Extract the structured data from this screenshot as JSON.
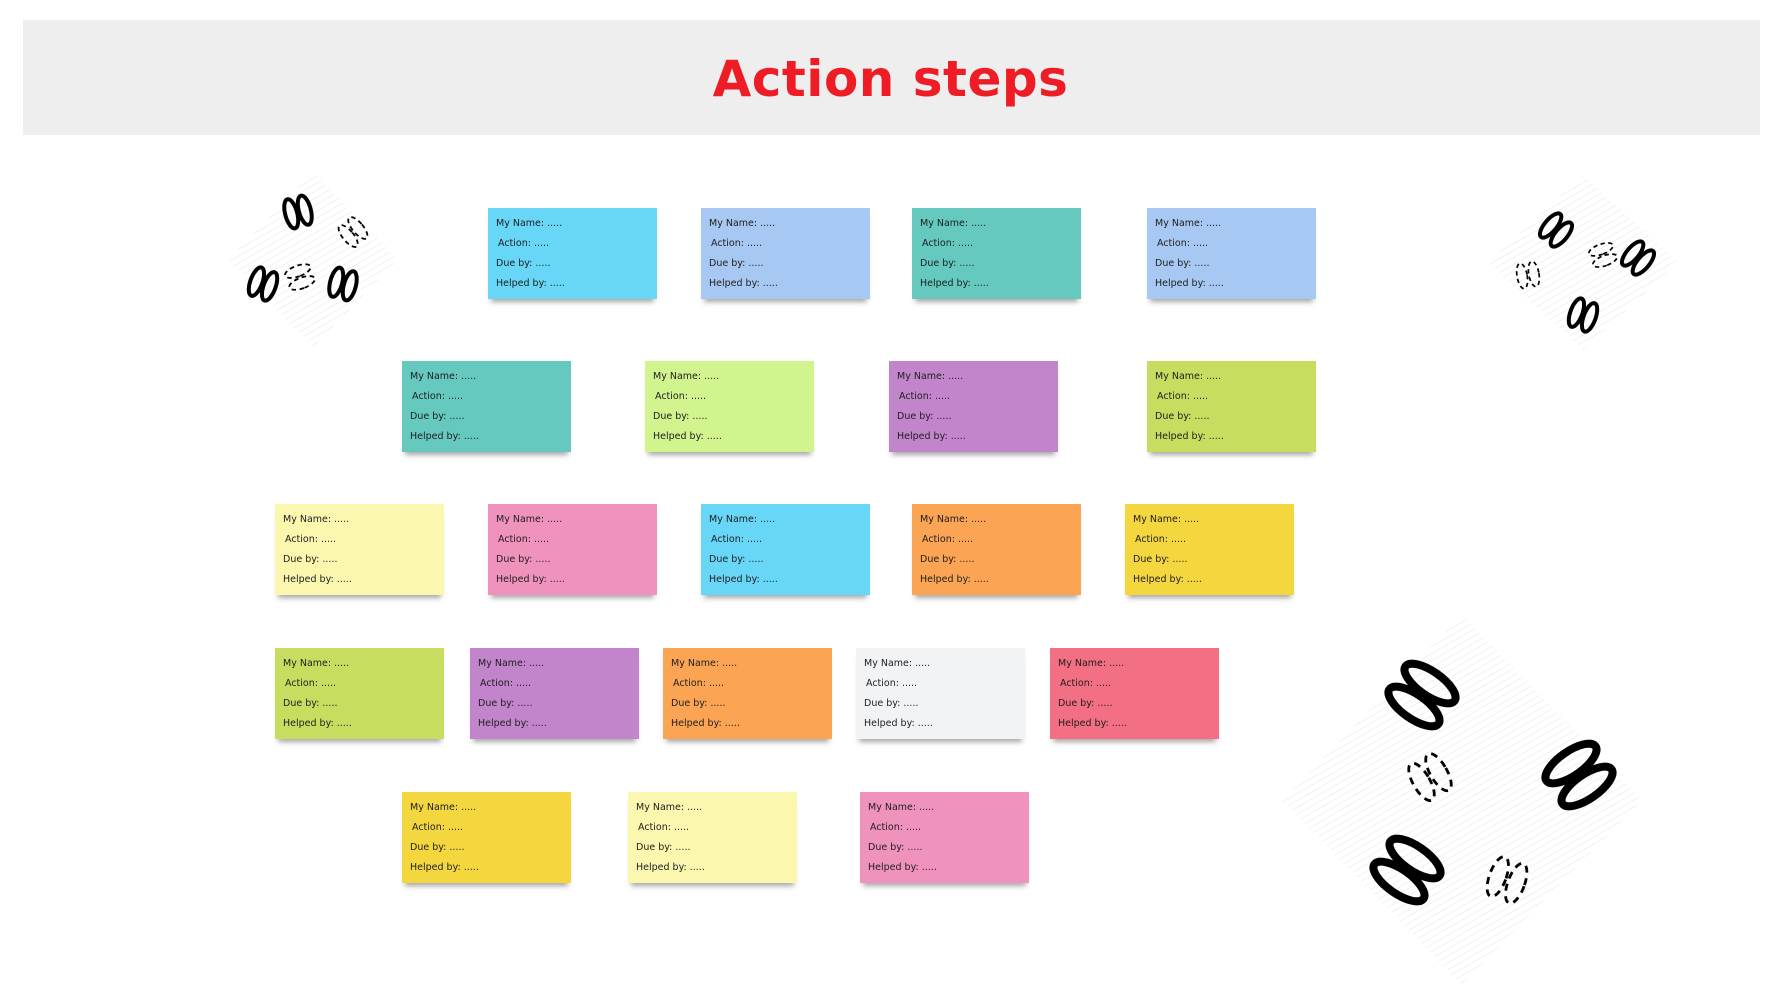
{
  "header": {
    "title": "Action steps"
  },
  "note_template": {
    "name": "My Name: .....",
    "action": "Action: .....",
    "due": "Due by: .....",
    "helped": "Helped by: ....."
  },
  "colors": {
    "header_bg": "#eeeeee",
    "title": "#ee1c25"
  },
  "notes": [
    {
      "color": "#67d6f7"
    },
    {
      "color": "#a7c8f2"
    },
    {
      "color": "#65c9bf"
    },
    {
      "color": "#a7c8f2"
    },
    {
      "color": "#65c9bf"
    },
    {
      "color": "#d1f48f"
    },
    {
      "color": "#c285cb"
    },
    {
      "color": "#c6dd60"
    },
    {
      "color": "#fbf7af"
    },
    {
      "color": "#f093bc"
    },
    {
      "color": "#67d6f7"
    },
    {
      "color": "#fba453"
    },
    {
      "color": "#f4d63f"
    },
    {
      "color": "#c6dd60"
    },
    {
      "color": "#c285cb"
    },
    {
      "color": "#fba453"
    },
    {
      "color": "#f2f3f4"
    },
    {
      "color": "#f36f83"
    },
    {
      "color": "#f4d63f"
    },
    {
      "color": "#fbf7af"
    },
    {
      "color": "#f093bc"
    }
  ],
  "decorations": [
    {
      "name": "footprints-icon-top-left"
    },
    {
      "name": "footprints-icon-top-right"
    },
    {
      "name": "footprints-icon-bottom-right"
    }
  ]
}
